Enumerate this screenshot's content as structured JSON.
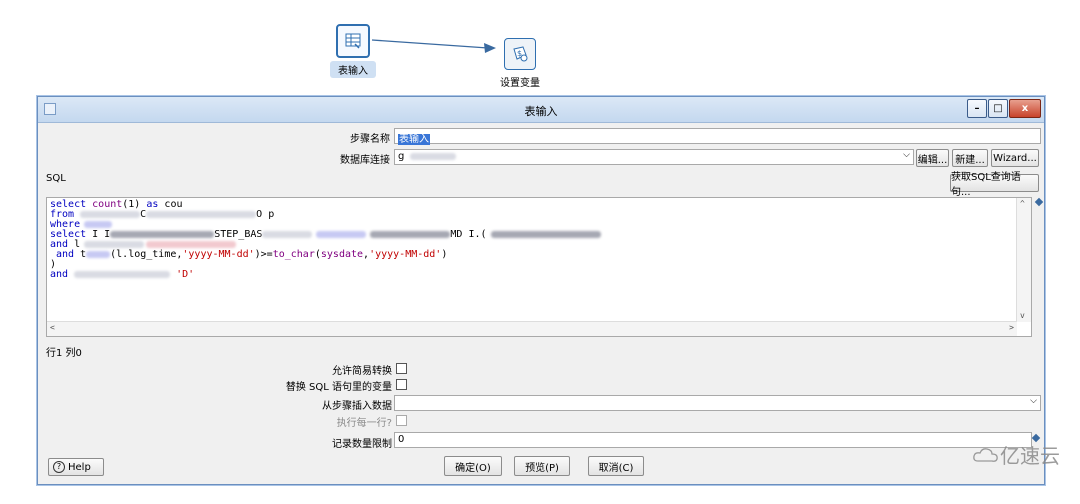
{
  "canvas": {
    "node1_label": "表输入",
    "node2_label": "设置变量"
  },
  "dialog": {
    "title": "表输入",
    "step_name_label": "步骤名称",
    "step_name_value": "表输入",
    "db_conn_label": "数据库连接",
    "db_conn_value": "g",
    "edit_button": "编辑...",
    "new_button": "新建...",
    "wizard_button": "Wizard...",
    "sql_label": "SQL",
    "get_sql_button": "获取SQL查询语句...",
    "sql": {
      "l1_kw": "select ",
      "l1_fn": "count",
      "l1_rest": "(1) ",
      "l1_as": "as",
      "l1_alias": " cou",
      "l2_kw": "from",
      "l2_frag": "C",
      "l2_end": "O p",
      "l3": "where",
      "l4_kw": "select",
      "l4_a": " I I",
      "l4_b": "STEP_BAS",
      "l4_c": "MD I.(",
      "l5_kw": "and",
      "l5_a": " l",
      "l6_kw": " and",
      "l6_a": " t",
      "l6_b": "(l.log_time,",
      "l6_s1": "'yyyy-MM-dd'",
      "l6_c": ")>=",
      "l6_fn": "to_char",
      "l6_d": "(",
      "l6_fn2": "sysdate",
      "l6_e": ",",
      "l6_s2": "'yyyy-MM-dd'",
      "l6_f": ")",
      "l7": ")",
      "l8_kw": "and",
      "l8_s": "'D'"
    },
    "cursor_pos": "行1 列0",
    "lazy_label": "允许简易转换",
    "replace_vars_label": "替换 SQL 语句里的变量",
    "insert_from_step_label": "从步骤插入数据",
    "exec_each_row_label": "执行每一行?",
    "limit_label": "记录数量限制",
    "limit_value": "0",
    "help_button": "Help",
    "ok_button": "确定(O)",
    "preview_button": "预览(P)",
    "cancel_button": "取消(C)"
  },
  "watermark": "亿速云",
  "colors": {
    "keyword": "#0000c0",
    "function": "#800080",
    "string": "#c00000",
    "title_bar": "#c4d8ef",
    "close": "#c8432b"
  }
}
